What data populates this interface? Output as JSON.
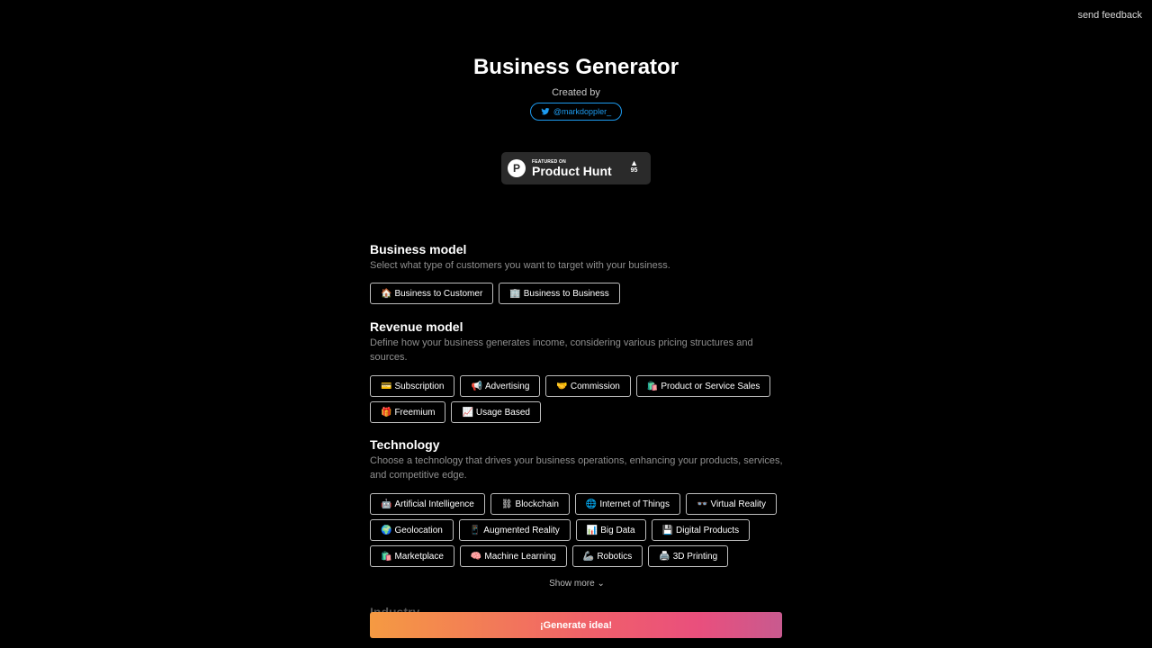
{
  "feedback": "send feedback",
  "header": {
    "title": "Business Generator",
    "created_by": "Created by",
    "twitter_handle": "@markdoppler_"
  },
  "producthunt": {
    "featured": "FEATURED ON",
    "name": "Product Hunt",
    "votes": "95"
  },
  "sections": {
    "business_model": {
      "title": "Business model",
      "description": "Select what type of customers you want to target with your business.",
      "options": [
        {
          "emoji": "🏠",
          "label": "Business to Customer"
        },
        {
          "emoji": "🏢",
          "label": "Business to Business"
        }
      ]
    },
    "revenue_model": {
      "title": "Revenue model",
      "description": "Define how your business generates income, considering various pricing structures and sources.",
      "options": [
        {
          "emoji": "💳",
          "label": "Subscription"
        },
        {
          "emoji": "📢",
          "label": "Advertising"
        },
        {
          "emoji": "🤝",
          "label": "Commission"
        },
        {
          "emoji": "🛍️",
          "label": "Product or Service Sales"
        },
        {
          "emoji": "🎁",
          "label": "Freemium"
        },
        {
          "emoji": "📈",
          "label": "Usage Based"
        }
      ]
    },
    "technology": {
      "title": "Technology",
      "description": "Choose a technology that drives your business operations, enhancing your products, services, and competitive edge.",
      "options": [
        {
          "emoji": "🤖",
          "label": "Artificial Intelligence"
        },
        {
          "emoji": "⛓",
          "label": "Blockchain"
        },
        {
          "emoji": "🌐",
          "label": "Internet of Things"
        },
        {
          "emoji": "👓",
          "label": "Virtual Reality"
        },
        {
          "emoji": "🌍",
          "label": "Geolocation"
        },
        {
          "emoji": "📱",
          "label": "Augmented Reality"
        },
        {
          "emoji": "📊",
          "label": "Big Data"
        },
        {
          "emoji": "💾",
          "label": "Digital Products"
        },
        {
          "emoji": "🛍️",
          "label": "Marketplace"
        },
        {
          "emoji": "🧠",
          "label": "Machine Learning"
        },
        {
          "emoji": "🦾",
          "label": "Robotics"
        },
        {
          "emoji": "🖨️",
          "label": "3D Printing"
        }
      ],
      "show_more": "Show more"
    },
    "industry": {
      "title": "Industry"
    }
  },
  "generate_label": "¡Generate idea!",
  "colors": {
    "twitter": "#1d9bf0",
    "gradient_start": "#f59a42",
    "gradient_end": "#c85a8f"
  },
  "icons": [
    "twitter-icon",
    "producthunt-logo-icon",
    "upvote-triangle-icon",
    "chevron-down-icon"
  ]
}
